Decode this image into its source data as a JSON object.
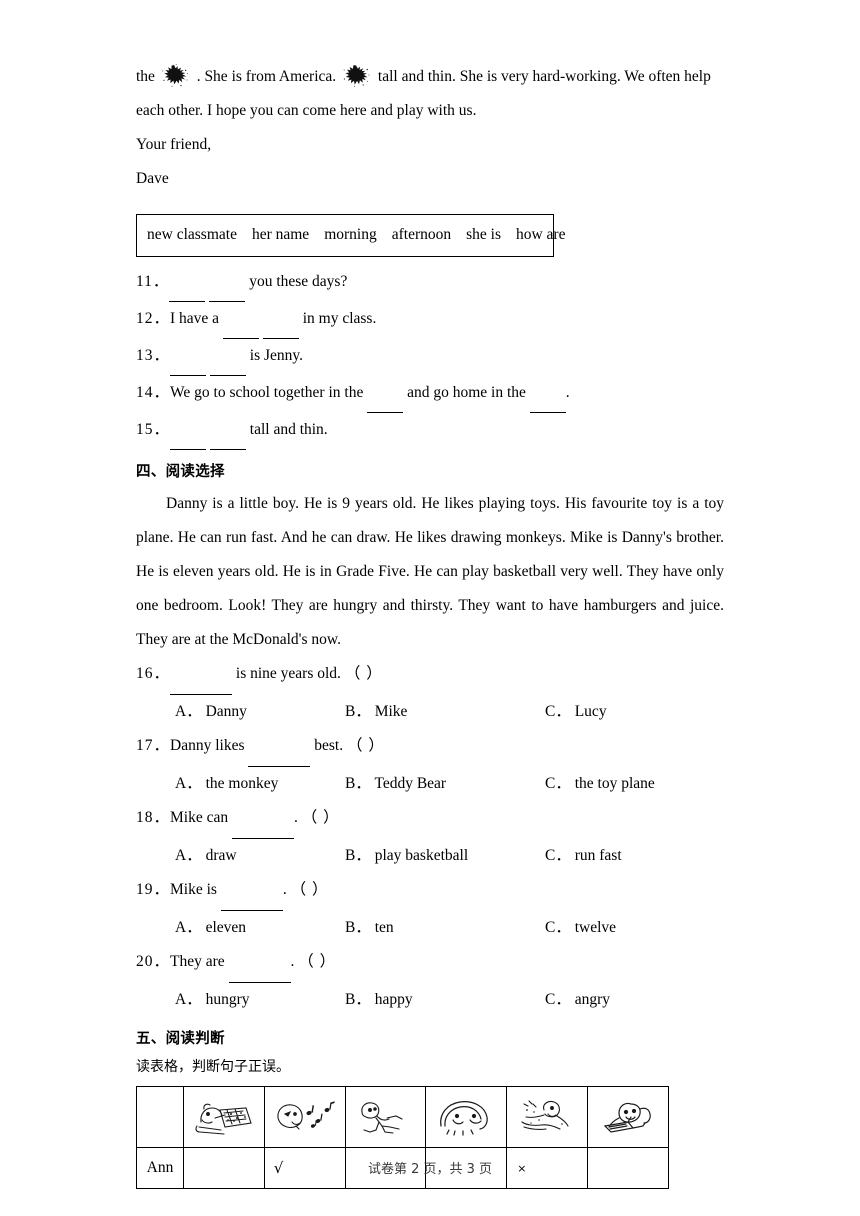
{
  "letter": {
    "line1_before_blot1": "the",
    "line1_mid": ". She is from America.",
    "line1_after_blot2": "tall and thin. She is very hard-working. We often help",
    "line2": "each other. I hope you can come here and play with us.",
    "closing": "Your friend,",
    "signature": "Dave"
  },
  "word_bank": {
    "items": [
      "new classmate",
      "her name",
      "morning",
      "afternoon",
      "she is",
      "how are"
    ]
  },
  "fill_questions": [
    {
      "num": "11．",
      "parts": [
        {
          "type": "blank",
          "size": "m"
        },
        {
          "type": "text",
          "value": " "
        },
        {
          "type": "blank",
          "size": "m"
        },
        {
          "type": "text",
          "value": "  you these days?"
        }
      ]
    },
    {
      "num": "12．",
      "parts": [
        {
          "type": "text",
          "value": "I have a "
        },
        {
          "type": "blank",
          "size": "m"
        },
        {
          "type": "text",
          "value": " "
        },
        {
          "type": "blank",
          "size": "m"
        },
        {
          "type": "text",
          "value": "  in my class."
        }
      ]
    },
    {
      "num": "13．",
      "parts": [
        {
          "type": "blank",
          "size": "m"
        },
        {
          "type": "text",
          "value": " "
        },
        {
          "type": "blank",
          "size": "m"
        },
        {
          "type": "text",
          "value": "  is Jenny."
        }
      ]
    },
    {
      "num": "14．",
      "parts": [
        {
          "type": "text",
          "value": "We go to school together in the "
        },
        {
          "type": "blank",
          "size": "m"
        },
        {
          "type": "text",
          "value": "  and go home in the  "
        },
        {
          "type": "blank",
          "size": "m"
        },
        {
          "type": "text",
          "value": "."
        }
      ]
    },
    {
      "num": "15．",
      "parts": [
        {
          "type": "blank",
          "size": "m"
        },
        {
          "type": "text",
          "value": " "
        },
        {
          "type": "blank",
          "size": "m"
        },
        {
          "type": "text",
          "value": "  tall and thin."
        }
      ]
    }
  ],
  "section_four": {
    "heading": "四、阅读选择",
    "passage": [
      "Danny is a little boy. He is 9 years old. He likes playing toys. His favourite toy is a toy plane. He can run fast. And he can draw. He likes drawing monkeys. Mike is Danny's brother. He is eleven years old. He is in Grade Five. He can play basketball very well. They have only one bedroom. Look! They are hungry and thirsty. They want to have hamburgers and juice. They are at the McDonald's now."
    ],
    "questions": [
      {
        "num": "16．",
        "stem_before": "",
        "stem_blank": true,
        "stem_after": " is nine years old.",
        "paren": "（  ）",
        "options": [
          {
            "key": "A．",
            "text": "Danny"
          },
          {
            "key": "B．",
            "text": "Mike"
          },
          {
            "key": "C．",
            "text": "Lucy"
          }
        ]
      },
      {
        "num": "17．",
        "stem_before": "Danny likes",
        "stem_blank": true,
        "stem_after": " best.",
        "paren": "（  ）",
        "options": [
          {
            "key": "A．",
            "text": "the monkey"
          },
          {
            "key": "B．",
            "text": "Teddy Bear"
          },
          {
            "key": "C．",
            "text": "the toy plane"
          }
        ]
      },
      {
        "num": "18．",
        "stem_before": "Mike can",
        "stem_blank": true,
        "stem_after": ".",
        "paren": "（  ）",
        "options": [
          {
            "key": "A．",
            "text": "draw"
          },
          {
            "key": "B．",
            "text": "play basketball"
          },
          {
            "key": "C．",
            "text": "run fast"
          }
        ]
      },
      {
        "num": "19．",
        "stem_before": "Mike is",
        "stem_blank": true,
        "stem_after": ".",
        "paren": "（  ）",
        "options": [
          {
            "key": "A．",
            "text": "eleven"
          },
          {
            "key": "B．",
            "text": "ten"
          },
          {
            "key": "C．",
            "text": "twelve"
          }
        ]
      },
      {
        "num": "20．",
        "stem_before": "They are",
        "stem_blank": true,
        "stem_after": ".",
        "paren": "（  ）",
        "options": [
          {
            "key": "A．",
            "text": "hungry"
          },
          {
            "key": "B．",
            "text": "happy"
          },
          {
            "key": "C．",
            "text": "angry"
          }
        ]
      }
    ]
  },
  "section_five": {
    "heading": "五、阅读判断",
    "instruction": "读表格，判断句子正误。",
    "table": {
      "corner_label": "",
      "picture_columns": [
        "drawing-picture",
        "singing-picture",
        "running-picture",
        "jumping-picture",
        "swimming-picture",
        "reading-picture"
      ],
      "rows": [
        {
          "name": "Ann",
          "marks": [
            "",
            "√",
            "",
            "",
            "×",
            ""
          ]
        }
      ]
    }
  },
  "footer": {
    "text": "试卷第 2 页，共 3 页"
  }
}
